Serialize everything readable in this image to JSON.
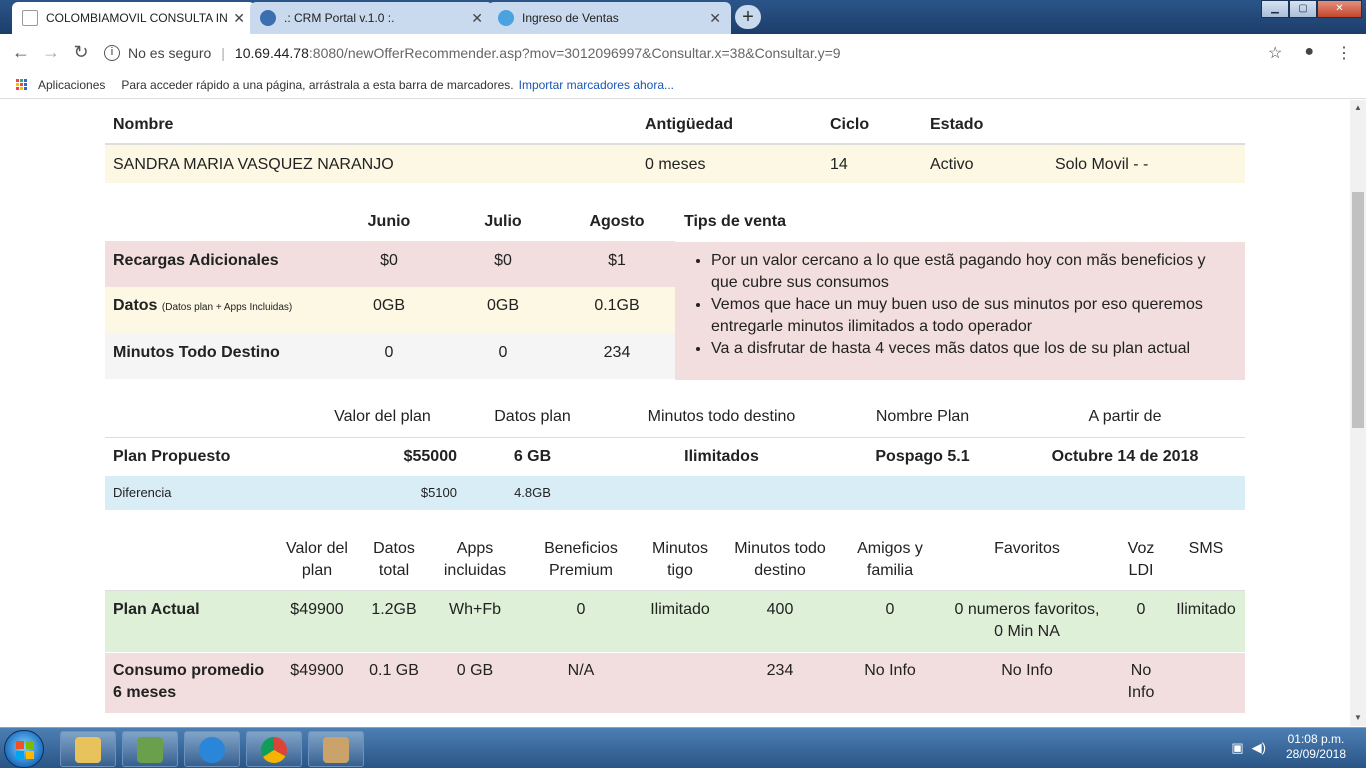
{
  "browser": {
    "tabs": [
      {
        "title": "COLOMBIAMOVIL CONSULTA IN",
        "active": true
      },
      {
        "title": ".: CRM Portal v.1.0 :.",
        "active": false
      },
      {
        "title": "Ingreso de Ventas",
        "active": false
      }
    ],
    "newtab_glyph": "+",
    "close_glyph": "✕",
    "security_label": "No es seguro",
    "url_host": "10.69.44.78",
    "url_rest": ":8080/newOfferRecommender.asp?mov=3012096997&Consultar.x=38&Consultar.y=9",
    "bookmarks": {
      "apps_label": "Aplicaciones",
      "hint": "Para acceder rápido a una página, arrástrala a esta barra de marcadores.",
      "import_link": "Importar marcadores ahora..."
    }
  },
  "client": {
    "headers": [
      "Nombre",
      "Antigüedad",
      "Ciclo",
      "Estado"
    ],
    "name": "SANDRA MARIA VASQUEZ NARANJO",
    "antiguedad": "0 meses",
    "ciclo": "14",
    "estado": "Activo",
    "tipo": "Solo Movil - -"
  },
  "consumption": {
    "months": [
      "Junio",
      "Julio",
      "Agosto"
    ],
    "tips_header": "Tips de venta",
    "rows": [
      {
        "label": "Recargas Adicionales",
        "note": "",
        "values": [
          "$0",
          "$0",
          "$1"
        ]
      },
      {
        "label": "Datos",
        "note": "(Datos plan + Apps Incluidas)",
        "values": [
          "0GB",
          "0GB",
          "0.1GB"
        ]
      },
      {
        "label": "Minutos Todo Destino",
        "note": "",
        "values": [
          "0",
          "0",
          "234"
        ]
      }
    ],
    "tips": [
      "Por un valor cercano a lo que estã pagando hoy con mãs beneficios y que cubre sus consumos",
      "Vemos que hace un muy buen uso de sus minutos por eso queremos entregarle minutos ilimitados a todo operador",
      "Va a disfrutar de hasta 4 veces mãs datos que los de su plan actual"
    ]
  },
  "proposal": {
    "headers": [
      "Valor del plan",
      "Datos plan",
      "Minutos todo destino",
      "Nombre Plan",
      "A partir de"
    ],
    "label": "Plan Propuesto",
    "valor": "$55000",
    "datos": "6 GB",
    "minutos": "Ilimitados",
    "nombre": "Pospago 5.1",
    "fecha": "Octubre 14 de 2018",
    "diff_label": "Diferencia",
    "diff_valor": "$5100",
    "diff_datos": "4.8GB"
  },
  "current": {
    "headers": [
      [
        "Valor del",
        "plan"
      ],
      [
        "Datos",
        "total"
      ],
      [
        "Apps",
        "incluidas"
      ],
      [
        "Beneficios",
        "Premium"
      ],
      [
        "Minutos",
        "tigo"
      ],
      [
        "Minutos todo",
        "destino"
      ],
      [
        "Amigos y",
        "familia"
      ],
      [
        "Favoritos",
        ""
      ],
      [
        "Voz",
        "LDI"
      ],
      [
        "SMS",
        ""
      ]
    ],
    "plan_actual": {
      "label": "Plan Actual",
      "values": [
        "$49900",
        "1.2GB",
        "Wh+Fb",
        "0",
        "Ilimitado",
        "400",
        "0",
        "0 numeros favoritos,",
        "0",
        "Ilimitado"
      ],
      "favoritos_line2": "0 Min NA"
    },
    "consumo": {
      "label1": "Consumo promedio",
      "label2": "6 meses",
      "values": [
        "$49900",
        "0.1 GB",
        "0 GB",
        "N/A",
        "",
        "234",
        "No Info",
        "No Info",
        "No",
        ""
      ],
      "voz_line2": "Info"
    }
  },
  "taskbar": {
    "time": "01:08 p.m.",
    "date": "28/09/2018"
  }
}
